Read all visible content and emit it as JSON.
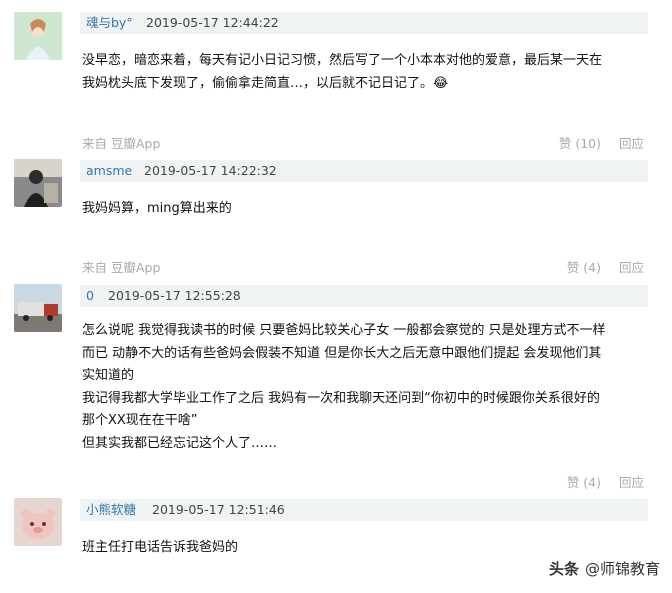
{
  "comments": [
    {
      "user": "魂与by°",
      "time": "2019-05-17 12:44:22",
      "lines": [
        "没早恋，暗恋来着，每天有记小日记习惯，然后写了一个小本本对他的爱意，最后某一天在",
        "我妈枕头底下发现了，偷偷拿走简直…，以后就不记日记了。😂"
      ],
      "source": "来自 豆瓣App",
      "like": "赞 (10)",
      "reply": "回应"
    },
    {
      "user": "amsme",
      "time": "2019-05-17 14:22:32",
      "lines": [
        "我妈妈算，ming算出来的"
      ],
      "source": "来自 豆瓣App",
      "like": "赞 (4)",
      "reply": "回应"
    },
    {
      "user": "0",
      "time": "2019-05-17 12:55:28",
      "lines": [
        "怎么说呢 我觉得我读书的时候 只要爸妈比较关心子女 一般都会察觉的 只是处理方式不一样",
        "而已 动静不大的话有些爸妈会假装不知道 但是你长大之后无意中跟他们提起 会发现他们其",
        "实知道的",
        "我记得我都大学毕业工作了之后 我妈有一次和我聊天还问到“你初中的时候跟你关系很好的",
        "那个XX现在在干啥”",
        "但其实我都已经忘记这个人了……"
      ],
      "source": "",
      "like": "赞 (4)",
      "reply": "回应"
    },
    {
      "user": "小熊软糖",
      "time": "2019-05-17 12:51:46",
      "lines": [
        "班主任打电话告诉我爸妈的"
      ],
      "source": "",
      "like": "",
      "reply": ""
    }
  ],
  "watermark": {
    "logo": "头条",
    "text": "@师锦教育"
  },
  "colors": {
    "username": "#3377aa",
    "meta_bg": "#f0f3f3",
    "muted": "#aaaaaa"
  }
}
